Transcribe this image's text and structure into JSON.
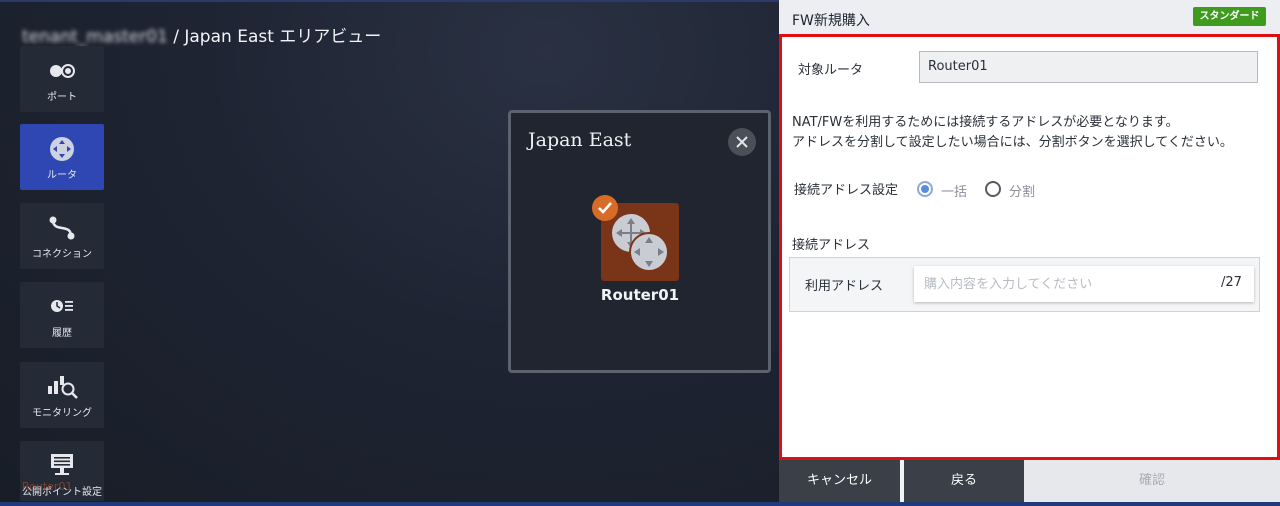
{
  "breadcrumb": {
    "tenant": "tenant_master01",
    "path": " / Japan East エリアビュー"
  },
  "sidebar": {
    "items": [
      {
        "label": "ポート",
        "icon": "port-icon"
      },
      {
        "label": "ルータ",
        "icon": "router-icon",
        "active": true
      },
      {
        "label": "コネクション",
        "icon": "connection-icon"
      },
      {
        "label": "履歴",
        "icon": "history-icon"
      },
      {
        "label": "モニタリング",
        "icon": "monitoring-icon"
      },
      {
        "label": "公開ポイント設定",
        "icon": "public-point-icon"
      }
    ],
    "ghost_label": "Router01"
  },
  "region_card": {
    "title": "Japan East",
    "router": {
      "name": "Router01",
      "selected": true
    }
  },
  "panel": {
    "title": "FW新規購入",
    "badge": "スタンダード",
    "target_router_label": "対象ルータ",
    "target_router_value": "Router01",
    "description_line1": "NAT/FWを利用するためには接続するアドレスが必要となります。",
    "description_line2": "アドレスを分割して設定したい場合には、分割ボタンを選択してください。",
    "address_setting_label": "接続アドレス設定",
    "radio_options": [
      {
        "label": "一括",
        "checked": true
      },
      {
        "label": "分割",
        "checked": false
      }
    ],
    "connection_address_heading": "接続アドレス",
    "use_address_label": "利用アドレス",
    "use_address_placeholder": "購入内容を入力してください",
    "use_address_value": "",
    "prefix_suffix": "/27"
  },
  "footer": {
    "cancel": "キャンセル",
    "back": "戻る",
    "confirm": "確認"
  },
  "colors": {
    "active_sidebar": "#2f47b3",
    "badge": "#3e9b1e",
    "highlight_frame": "#e00d14",
    "router_node": "#7a3418",
    "check": "#d96b28"
  }
}
